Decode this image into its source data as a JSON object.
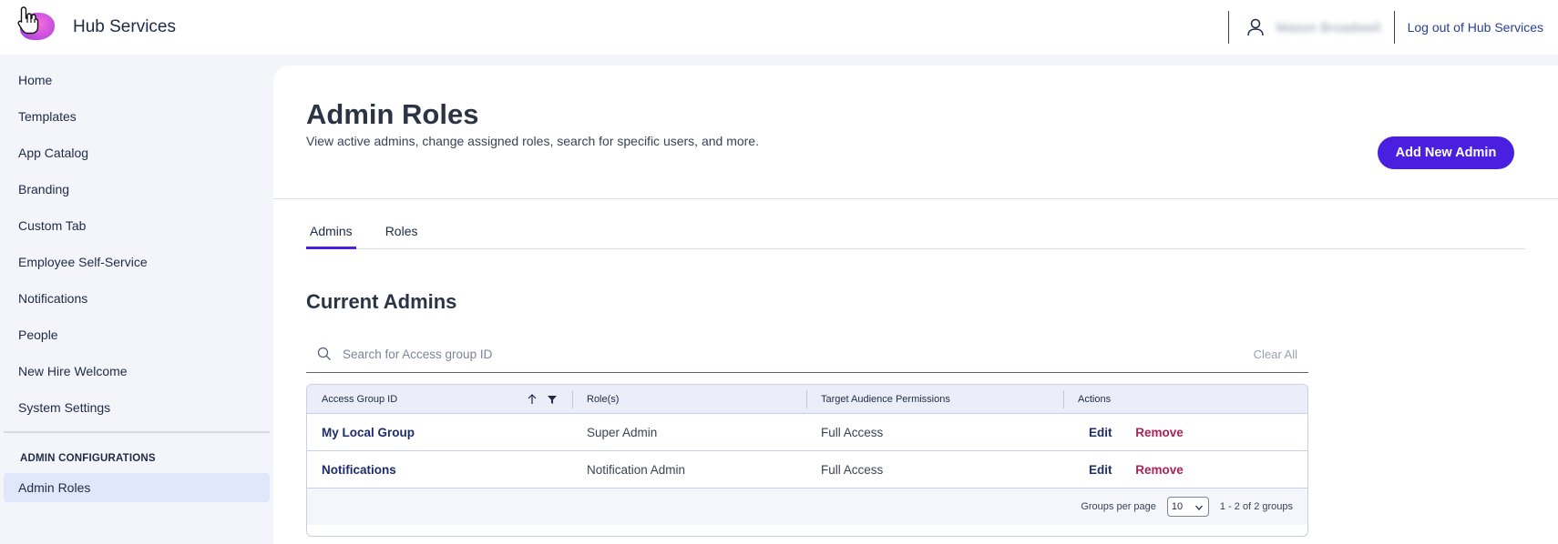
{
  "header": {
    "app_title": "Hub Services",
    "user_name": "Mason Broadwell",
    "logout_label": "Log out of Hub Services"
  },
  "sidebar": {
    "items": [
      {
        "label": "Home"
      },
      {
        "label": "Templates"
      },
      {
        "label": "App Catalog"
      },
      {
        "label": "Branding"
      },
      {
        "label": "Custom Tab"
      },
      {
        "label": "Employee Self-Service"
      },
      {
        "label": "Notifications"
      },
      {
        "label": "People"
      },
      {
        "label": "New Hire Welcome"
      },
      {
        "label": "System Settings"
      }
    ],
    "section_label": "ADMIN CONFIGURATIONS",
    "active_item": "Admin Roles"
  },
  "page": {
    "title": "Admin Roles",
    "subtitle": "View active admins, change assigned roles, search for specific users, and more.",
    "add_button_label": "Add New Admin",
    "tabs": [
      {
        "label": "Admins",
        "active": true
      },
      {
        "label": "Roles",
        "active": false
      }
    ],
    "section_title": "Current Admins",
    "search": {
      "placeholder": "Search for Access group ID",
      "value": "",
      "clear_label": "Clear All"
    }
  },
  "table": {
    "columns": [
      "Access Group ID",
      "Role(s)",
      "Target Audience Permissions",
      "Actions"
    ],
    "rows": [
      {
        "group": "My Local Group",
        "role": "Super Admin",
        "permissions": "Full Access",
        "edit": "Edit",
        "remove": "Remove"
      },
      {
        "group": "Notifications",
        "role": "Notification Admin",
        "permissions": "Full Access",
        "edit": "Edit",
        "remove": "Remove"
      }
    ],
    "footer": {
      "per_page_label": "Groups per page",
      "per_page_value": "10",
      "range_label": "1 - 2 of 2 groups"
    }
  },
  "colors": {
    "accent": "#4a1fe0",
    "link": "#1d2c6b",
    "danger": "#a8245a",
    "sidebar_active_bg": "#e1e7fb"
  }
}
